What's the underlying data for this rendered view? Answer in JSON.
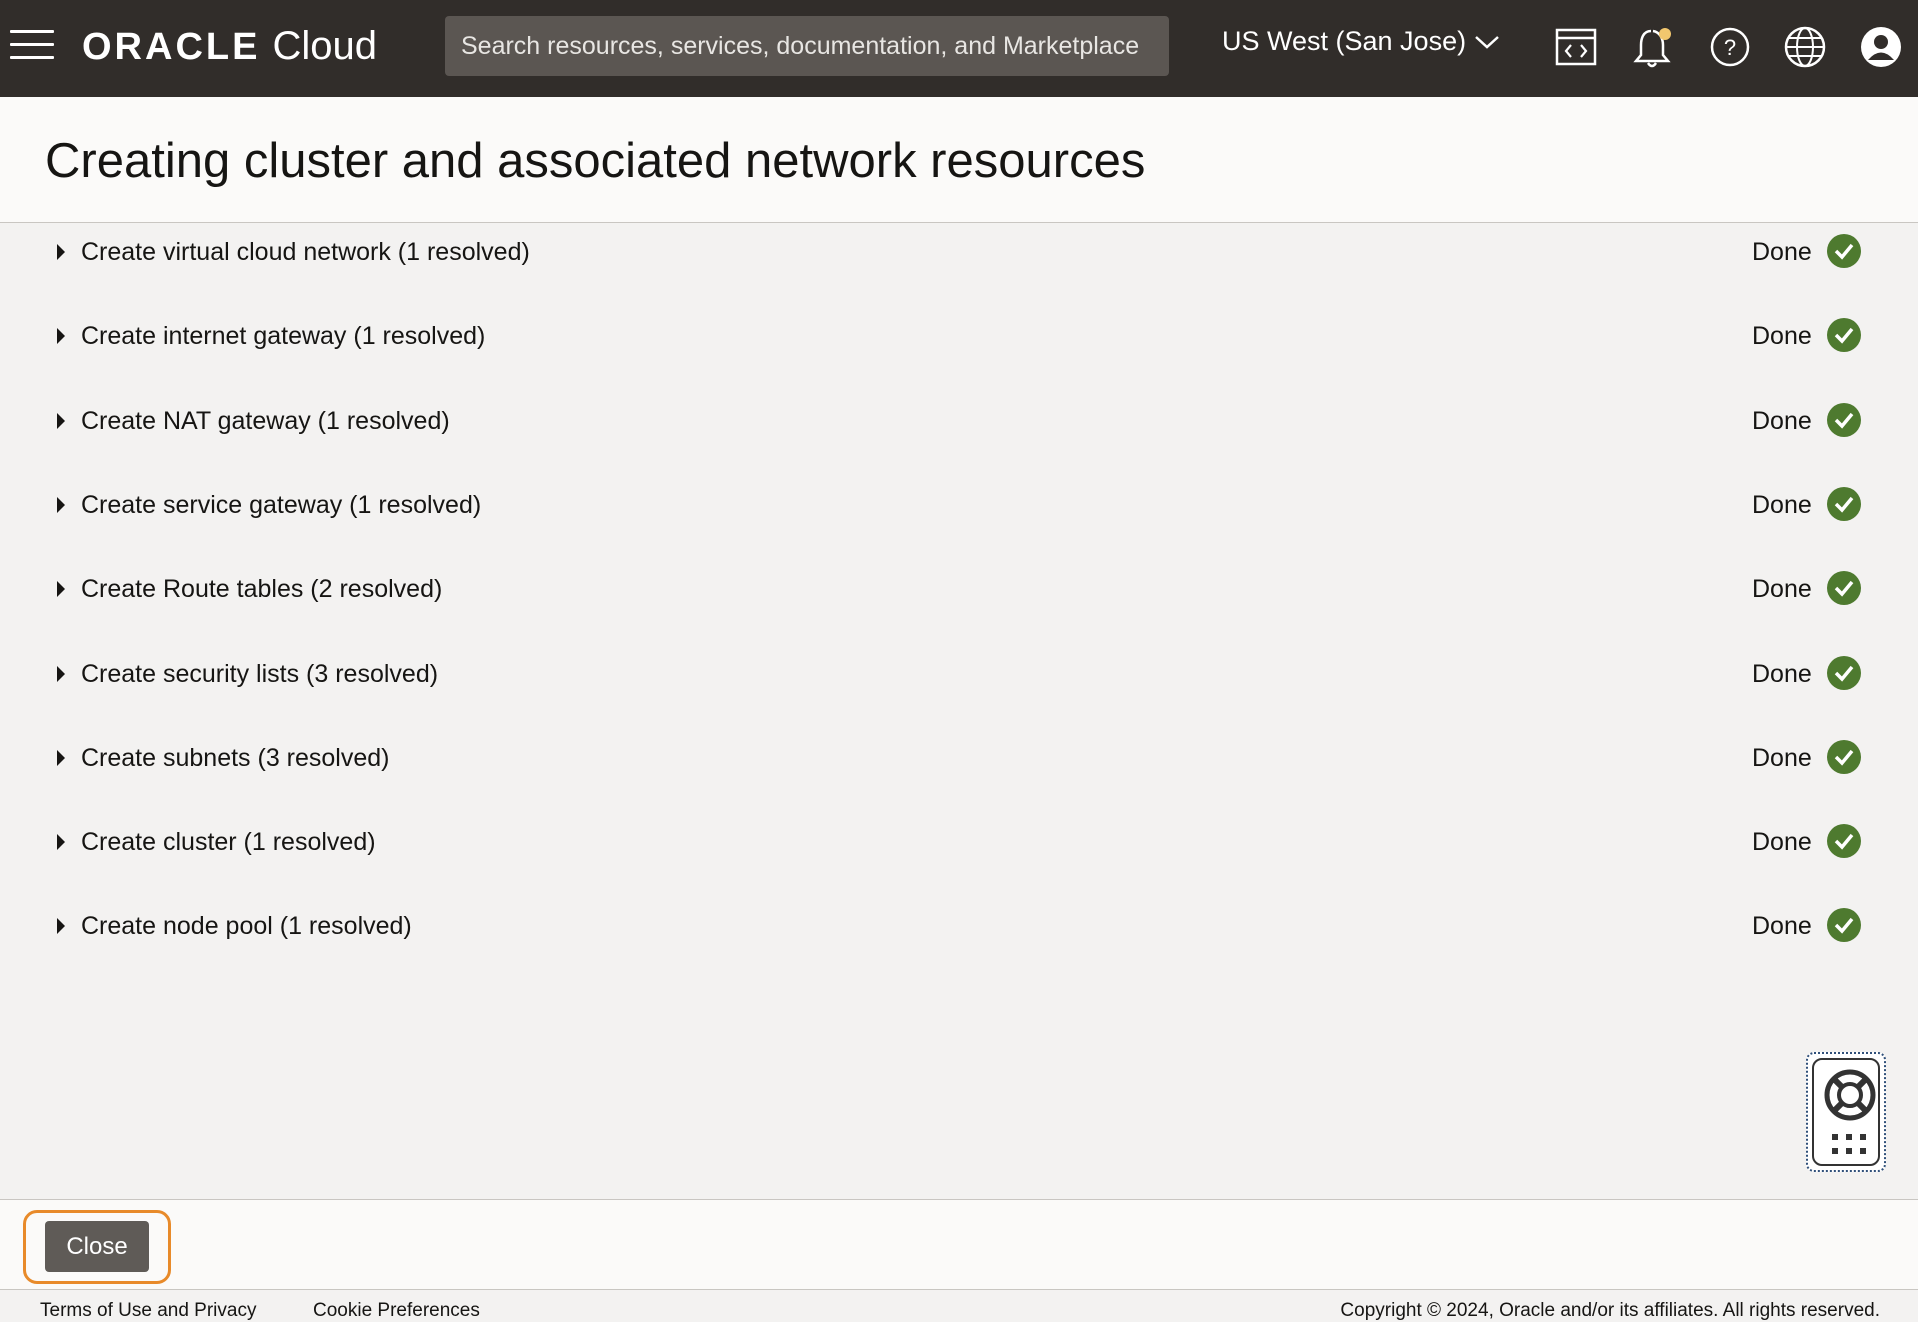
{
  "topbar": {
    "logo_oracle": "ORACLE",
    "logo_cloud": "Cloud",
    "search_placeholder": "Search resources, services, documentation, and Marketplace",
    "region": "US West (San Jose)"
  },
  "page": {
    "title": "Creating cluster and associated network resources"
  },
  "steps": [
    {
      "label": "Create virtual cloud network (1 resolved)",
      "status": "Done"
    },
    {
      "label": "Create internet gateway (1 resolved)",
      "status": "Done"
    },
    {
      "label": "Create NAT gateway (1 resolved)",
      "status": "Done"
    },
    {
      "label": "Create service gateway (1 resolved)",
      "status": "Done"
    },
    {
      "label": "Create Route tables (2 resolved)",
      "status": "Done"
    },
    {
      "label": "Create security lists (3 resolved)",
      "status": "Done"
    },
    {
      "label": "Create subnets (3 resolved)",
      "status": "Done"
    },
    {
      "label": "Create cluster (1 resolved)",
      "status": "Done"
    },
    {
      "label": "Create node pool (1 resolved)",
      "status": "Done"
    }
  ],
  "footer": {
    "close_label": "Close",
    "terms": "Terms of Use and Privacy",
    "cookies": "Cookie Preferences",
    "copyright": "Copyright © 2024, Oracle and/or its affiliates. All rights reserved."
  },
  "colors": {
    "topbar": "#312d2a",
    "success": "#4e7a2f",
    "focus_ring": "#e88a2a"
  },
  "icons": [
    "menu-icon",
    "chevron-down-icon",
    "code-editor-icon",
    "bell-icon",
    "help-icon",
    "globe-icon",
    "user-icon",
    "check-circle-icon",
    "caret-right-icon",
    "lifebuoy-icon",
    "grid-icon"
  ]
}
